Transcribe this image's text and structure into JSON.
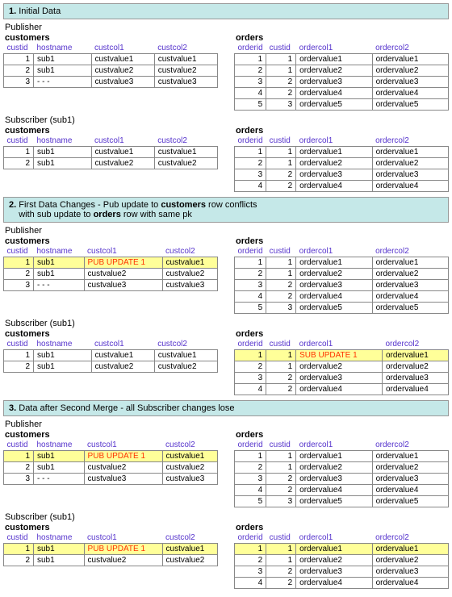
{
  "sections": [
    {
      "num": "1.",
      "title": "Initial Data"
    },
    {
      "num": "2.",
      "title": "First Data Changes - Pub update to <b>customers</b> row conflicts<br>&nbsp;&nbsp;&nbsp;&nbsp;with sub update to <b>orders</b> row with same pk"
    },
    {
      "num": "3.",
      "title": "Data after Second Merge - all Subscriber changes lose"
    }
  ],
  "roles": {
    "pub": "Publisher",
    "sub": "Subscriber (sub1)"
  },
  "tables": {
    "customers": "customers",
    "orders": "orders"
  },
  "cust_hdr": [
    "custid",
    "hostname",
    "custcol1",
    "custcol2"
  ],
  "ord_hdr": [
    "orderid",
    "custid",
    "ordercol1",
    "ordercol2"
  ],
  "pub_cust": [
    [
      "1",
      "sub1",
      "custvalue1",
      "custvalue1"
    ],
    [
      "2",
      "sub1",
      "custvalue2",
      "custvalue2"
    ],
    [
      "3",
      "- - -",
      "custvalue3",
      "custvalue3"
    ]
  ],
  "pub_ord": [
    [
      "1",
      "1",
      "ordervalue1",
      "ordervalue1"
    ],
    [
      "2",
      "1",
      "ordervalue2",
      "ordervalue2"
    ],
    [
      "3",
      "2",
      "ordervalue3",
      "ordervalue3"
    ],
    [
      "4",
      "2",
      "ordervalue4",
      "ordervalue4"
    ],
    [
      "5",
      "3",
      "ordervalue5",
      "ordervalue5"
    ]
  ],
  "sub_cust": [
    [
      "1",
      "sub1",
      "custvalue1",
      "custvalue1"
    ],
    [
      "2",
      "sub1",
      "custvalue2",
      "custvalue2"
    ]
  ],
  "sub_ord": [
    [
      "1",
      "1",
      "ordervalue1",
      "ordervalue1"
    ],
    [
      "2",
      "1",
      "ordervalue2",
      "ordervalue2"
    ],
    [
      "3",
      "2",
      "ordervalue3",
      "ordervalue3"
    ],
    [
      "4",
      "2",
      "ordervalue4",
      "ordervalue4"
    ]
  ],
  "pub_update": "PUB UPDATE 1",
  "sub_update": "SUB UPDATE 1"
}
